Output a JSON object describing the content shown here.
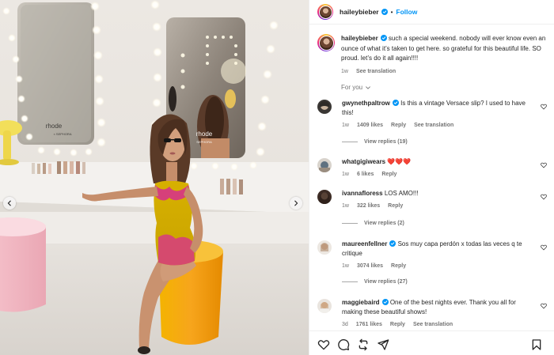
{
  "post": {
    "author": "haileybieber",
    "separator": "•",
    "follow_label": "Follow",
    "accent": "#0095f6",
    "verified_color": "#0095f6"
  },
  "media": {
    "signs": {
      "left_brand": "rhode",
      "left_sub": "× SEPHORA",
      "right_brand": "rhode",
      "right_sub": "SEPHORA"
    },
    "prev_icon": "chevron-left-icon",
    "next_icon": "chevron-right-icon"
  },
  "caption": {
    "username": "haileybieber",
    "text": "such a special weekend. nobody will ever know even an ounce of what it’s taken to get here. so grateful for this beautiful life. SO proud. let’s do it all again!!!!",
    "time": "1w",
    "see_translation": "See translation"
  },
  "for_you": "For you",
  "comments": [
    {
      "username": "gwynethpaltrow",
      "verified": true,
      "text": "Is this a vintage Versace slip? I used to have this!",
      "time": "1w",
      "likes": "1409 likes",
      "reply": "Reply",
      "see_translation": "See translation",
      "view_replies": "View replies (19)"
    },
    {
      "username": "whatgigiwears",
      "verified": false,
      "text": "❤️❤️❤️",
      "time": "1w",
      "likes": "6 likes",
      "reply": "Reply"
    },
    {
      "username": "ivannafloress",
      "verified": false,
      "text": "LOS AMO!!!",
      "time": "1w",
      "likes": "322 likes",
      "reply": "Reply",
      "view_replies": "View replies (2)"
    },
    {
      "username": "maureenfellner",
      "verified": true,
      "text": "Sos muy capa perdón x todas las veces q te critique",
      "time": "1w",
      "likes": "3074 likes",
      "reply": "Reply",
      "view_replies": "View replies (27)"
    },
    {
      "username": "maggiebaird",
      "verified": true,
      "text": "One of the best nights ever. Thank you all for making these beautiful shows!",
      "time": "3d",
      "likes": "1761 likes",
      "reply": "Reply",
      "see_translation": "See translation"
    }
  ],
  "actions": {
    "like_icon": "heart-icon",
    "comment_icon": "comment-icon",
    "share_icon": "repost-icon",
    "send_icon": "send-icon",
    "save_icon": "bookmark-icon"
  }
}
